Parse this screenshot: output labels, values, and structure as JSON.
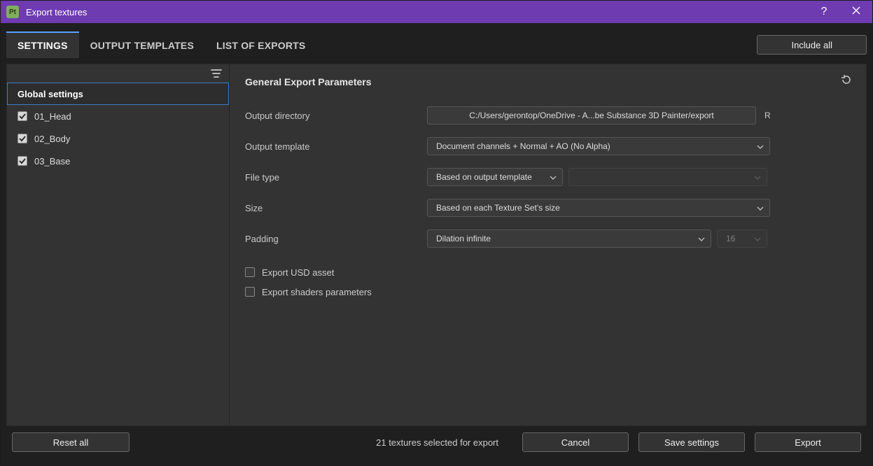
{
  "window": {
    "title": "Export textures",
    "app_icon_label": "Pt"
  },
  "tabs": {
    "settings": "SETTINGS",
    "output_templates": "OUTPUT TEMPLATES",
    "list_of_exports": "LIST OF EXPORTS"
  },
  "include_all": "Include all",
  "sidebar": {
    "header": "Global settings",
    "items": [
      {
        "label": "01_Head"
      },
      {
        "label": "02_Body"
      },
      {
        "label": "03_Base"
      }
    ]
  },
  "panel": {
    "title": "General Export Parameters",
    "rows": {
      "output_directory": {
        "label": "Output directory",
        "value": "C:/Users/gerontop/OneDrive - A...be Substance 3D Painter/export",
        "suffix": "R"
      },
      "output_template": {
        "label": "Output template",
        "value": "Document channels + Normal + AO (No Alpha)"
      },
      "file_type": {
        "label": "File type",
        "value": "Based on output template",
        "secondary": ""
      },
      "size": {
        "label": "Size",
        "value": "Based on each Texture Set's size"
      },
      "padding": {
        "label": "Padding",
        "value": "Dilation infinite",
        "amount": "16"
      }
    },
    "checks": {
      "export_usd": "Export USD asset",
      "export_shaders": "Export shaders parameters"
    }
  },
  "footer": {
    "reset_all": "Reset all",
    "status": "21 textures selected for export",
    "cancel": "Cancel",
    "save_settings": "Save settings",
    "export": "Export"
  }
}
